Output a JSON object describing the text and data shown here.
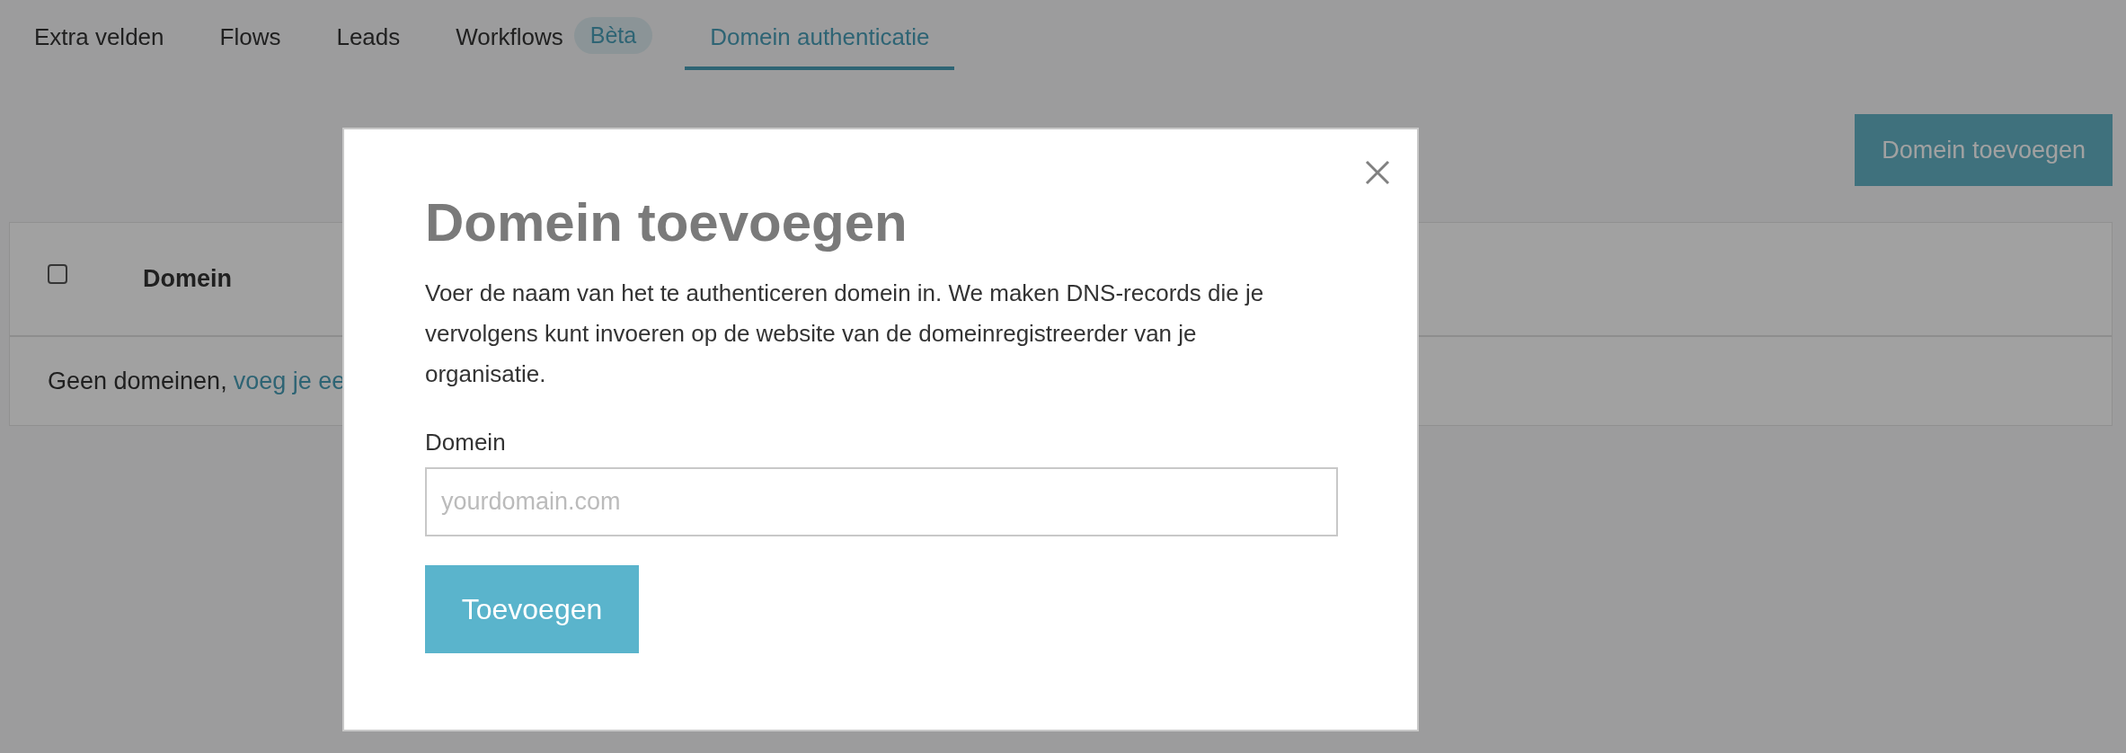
{
  "tabs": [
    {
      "label": "Extra velden",
      "selected": false
    },
    {
      "label": "Flows",
      "selected": false
    },
    {
      "label": "Leads",
      "selected": false
    },
    {
      "label": "Workflows",
      "selected": false,
      "badge": "Bèta"
    },
    {
      "label": "Domein authenticatie",
      "selected": true
    }
  ],
  "add_button": "Domein toevoegen",
  "table": {
    "select_all_checked": false,
    "columns": [
      "Domein"
    ],
    "empty_text": "Geen domeinen,",
    "empty_link": "voeg je ee"
  },
  "modal": {
    "title": "Domein toevoegen",
    "description": "Voer de naam van het te authenticeren domein in. We maken DNS-records die je vervolgens kunt invoeren op de website van de domeinregistreerder van je organisatie.",
    "field": {
      "label": "Domein",
      "placeholder": "yourdomain.com"
    },
    "submit": "Toevoegen"
  }
}
